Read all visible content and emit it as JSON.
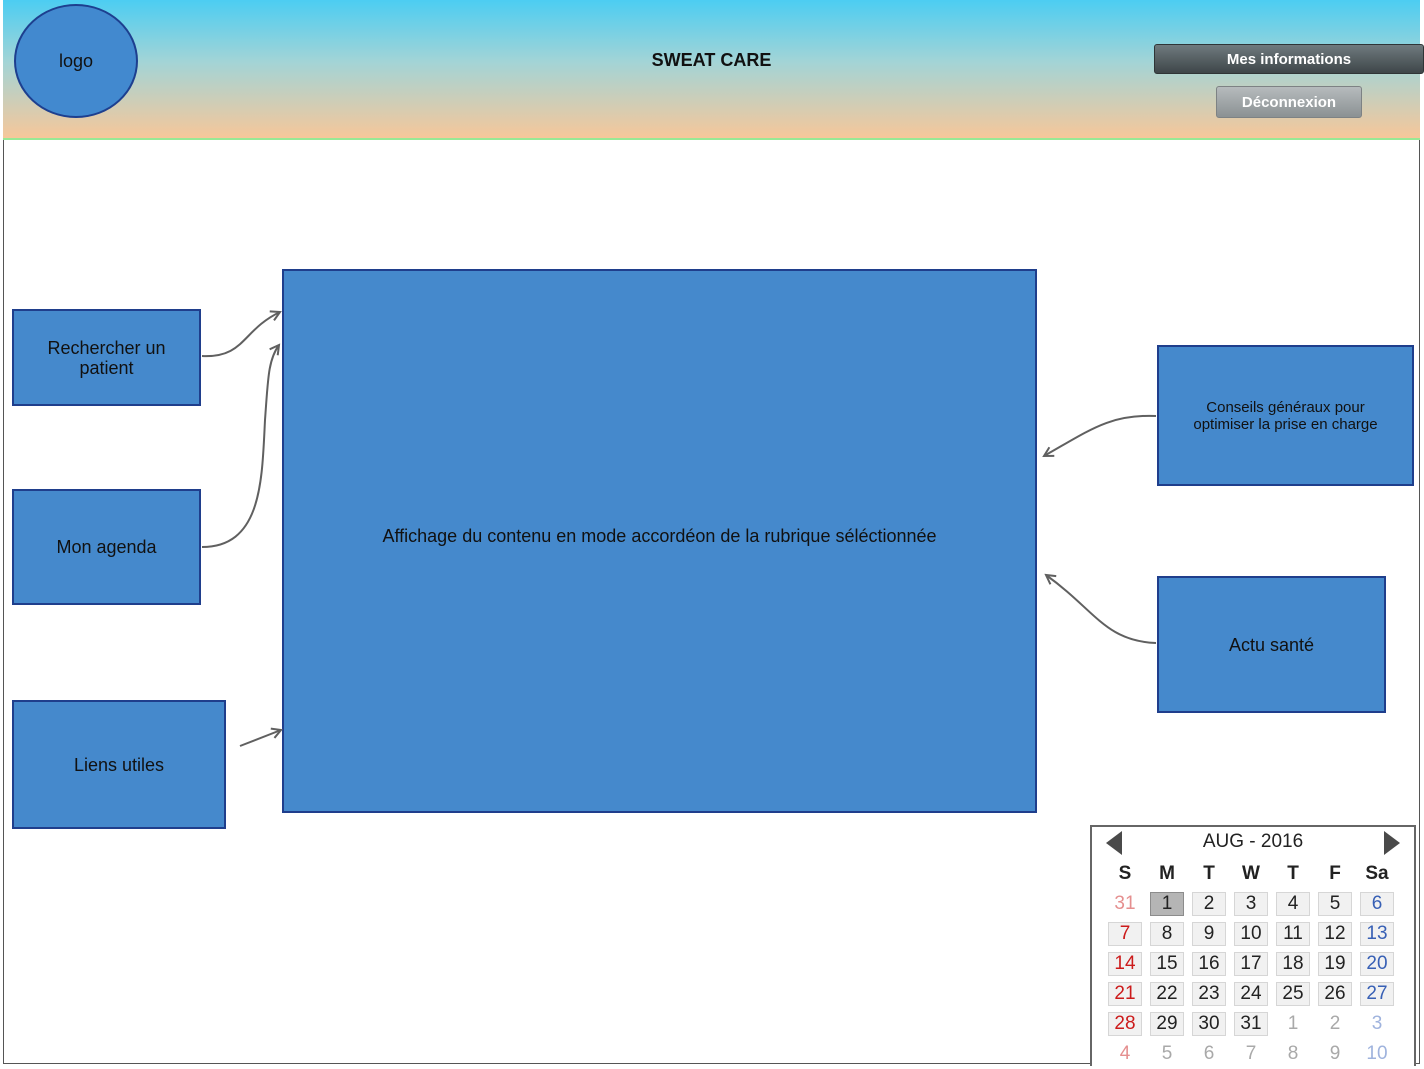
{
  "header": {
    "logo_label": "logo",
    "title": "SWEAT CARE",
    "my_info_button": "Mes informations",
    "logout_button": "Déconnexion"
  },
  "nav": {
    "search_patient": "Rechercher un patient",
    "my_agenda": "Mon agenda",
    "useful_links": "Liens utiles"
  },
  "main": {
    "content_text": "Affichage du contenu en mode accordéon de la rubrique séléctionnée"
  },
  "side": {
    "general_advice": "Conseils généraux pour optimiser la prise en charge",
    "health_news": "Actu santé"
  },
  "calendar": {
    "title": "AUG - 2016",
    "weekdays": [
      "S",
      "M",
      "T",
      "W",
      "T",
      "F",
      "Sa"
    ],
    "selected_day": "1",
    "weeks": [
      [
        {
          "d": "31",
          "other": true
        },
        {
          "d": "1"
        },
        {
          "d": "2"
        },
        {
          "d": "3"
        },
        {
          "d": "4"
        },
        {
          "d": "5"
        },
        {
          "d": "6"
        }
      ],
      [
        {
          "d": "7"
        },
        {
          "d": "8"
        },
        {
          "d": "9"
        },
        {
          "d": "10"
        },
        {
          "d": "11"
        },
        {
          "d": "12"
        },
        {
          "d": "13"
        }
      ],
      [
        {
          "d": "14"
        },
        {
          "d": "15"
        },
        {
          "d": "16"
        },
        {
          "d": "17"
        },
        {
          "d": "18"
        },
        {
          "d": "19"
        },
        {
          "d": "20"
        }
      ],
      [
        {
          "d": "21"
        },
        {
          "d": "22"
        },
        {
          "d": "23"
        },
        {
          "d": "24"
        },
        {
          "d": "25"
        },
        {
          "d": "26"
        },
        {
          "d": "27"
        }
      ],
      [
        {
          "d": "28"
        },
        {
          "d": "29"
        },
        {
          "d": "30"
        },
        {
          "d": "31"
        },
        {
          "d": "1",
          "other": true
        },
        {
          "d": "2",
          "other": true
        },
        {
          "d": "3",
          "other": true
        }
      ],
      [
        {
          "d": "4",
          "other": true
        },
        {
          "d": "5",
          "other": true
        },
        {
          "d": "6",
          "other": true
        },
        {
          "d": "7",
          "other": true
        },
        {
          "d": "8",
          "other": true
        },
        {
          "d": "9",
          "other": true
        },
        {
          "d": "10",
          "other": true
        }
      ]
    ]
  },
  "colors": {
    "box_fill": "#4589cc",
    "box_border": "#1f3e8c",
    "header_top": "#4ccdf2",
    "header_bottom": "#f6c79a",
    "sunday": "#cc1b1b",
    "saturday": "#3860b5"
  }
}
